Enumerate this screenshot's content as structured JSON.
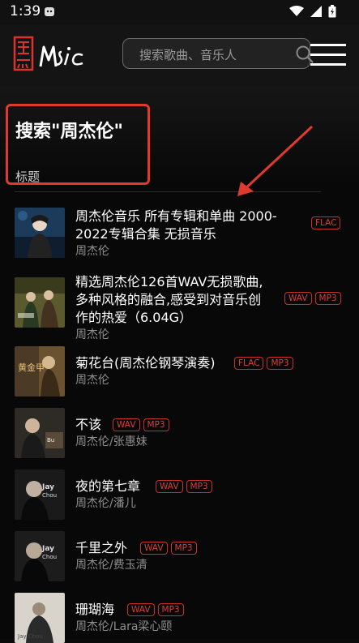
{
  "status_bar": {
    "time": "1:39"
  },
  "header": {
    "logo_text": "黑MUSIC",
    "search_placeholder": "搜索歌曲、音乐人"
  },
  "page": {
    "title": "搜索\"周杰伦\"",
    "column_label": "标题"
  },
  "colors": {
    "accent": "#e03a2f",
    "badge_border": "#c9302a",
    "background": "#0b0b0b"
  },
  "results": [
    {
      "title_lines": [
        "周杰伦音乐 所有专辑和单曲 2000-",
        "2022专辑合集 无损音乐"
      ],
      "artist": "周杰伦",
      "badges": [
        "FLAC"
      ]
    },
    {
      "title_lines": [
        "精选周杰伦126首WAV无损歌曲,",
        "多种风格的融合,感受到对音乐创",
        "作的热爱（6.04G）"
      ],
      "artist": "周杰伦",
      "badges": [
        "WAV",
        "MP3"
      ]
    },
    {
      "title_lines": [
        "菊花台(周杰伦钢琴演奏)"
      ],
      "artist": "周杰伦",
      "badges": [
        "FLAC",
        "MP3"
      ]
    },
    {
      "title_lines": [
        "不该"
      ],
      "artist": "周杰伦/张惠妹",
      "badges": [
        "WAV",
        "MP3"
      ]
    },
    {
      "title_lines": [
        "夜的第七章"
      ],
      "artist": "周杰伦/潘儿",
      "badges": [
        "WAV",
        "MP3"
      ]
    },
    {
      "title_lines": [
        "千里之外"
      ],
      "artist": "周杰伦/费玉清",
      "badges": [
        "WAV",
        "MP3"
      ]
    },
    {
      "title_lines": [
        "珊瑚海"
      ],
      "artist": "周杰伦/Lara梁心颐",
      "badges": [
        "WAV",
        "MP3"
      ]
    }
  ]
}
